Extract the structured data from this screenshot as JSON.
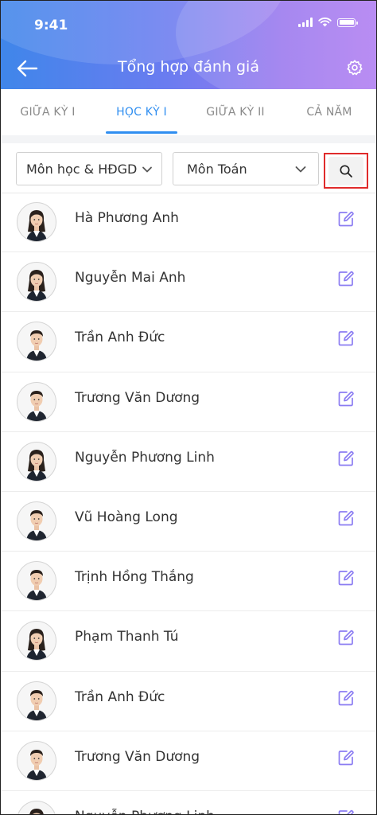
{
  "status": {
    "time": "9:41"
  },
  "header": {
    "title": "Tổng hợp đánh giá",
    "back_icon": "arrow-left-icon",
    "settings_icon": "gear-icon"
  },
  "colors": {
    "accent": "#2f8ef0",
    "edit_icon": "#8b7cf2",
    "highlight": "#e02b2b",
    "header_start": "#3f86ea",
    "header_end": "#b07ef2"
  },
  "tabs": [
    {
      "label": "GIỮA KỲ I",
      "active": false
    },
    {
      "label": "HỌC KỲ I",
      "active": true
    },
    {
      "label": "GIỮA KỲ II",
      "active": false
    },
    {
      "label": "CẢ NĂM",
      "active": false
    }
  ],
  "filters": {
    "category": {
      "value": "Môn học & HĐGD"
    },
    "subject": {
      "value": "Môn Toán"
    },
    "search_icon": "search-icon"
  },
  "students": [
    {
      "name": "Hà Phương Anh",
      "gender": "female"
    },
    {
      "name": "Nguyễn Mai Anh",
      "gender": "female"
    },
    {
      "name": "Trần Anh Đức",
      "gender": "male"
    },
    {
      "name": "Trương Văn Dương",
      "gender": "male"
    },
    {
      "name": "Nguyễn Phương Linh",
      "gender": "female"
    },
    {
      "name": "Vũ Hoàng Long",
      "gender": "male"
    },
    {
      "name": "Trịnh Hồng Thắng",
      "gender": "male"
    },
    {
      "name": "Phạm Thanh Tú",
      "gender": "female"
    },
    {
      "name": "Trần Anh Đức",
      "gender": "male"
    },
    {
      "name": "Trương Văn Dương",
      "gender": "male"
    },
    {
      "name": "Nguyễn Phương Linh",
      "gender": "female"
    }
  ]
}
